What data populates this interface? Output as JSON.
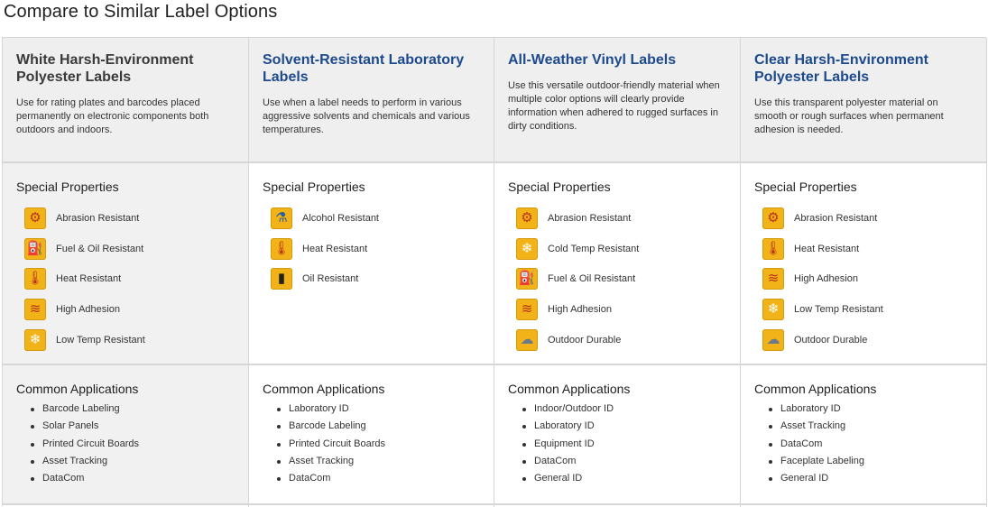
{
  "page": {
    "title": "Compare to Similar Label Options"
  },
  "sections": {
    "special_properties": "Special Properties",
    "common_applications": "Common Applications"
  },
  "products": [
    {
      "name": "White Harsh-Environment Polyester Labels",
      "description": "Use for rating plates and barcodes placed permanently on electronic components both outdoors and indoors.",
      "is_link": false,
      "properties": [
        {
          "label": "Abrasion Resistant",
          "icon": "abrasion-icon"
        },
        {
          "label": "Fuel & Oil Resistant",
          "icon": "fuel-oil-icon"
        },
        {
          "label": "Heat Resistant",
          "icon": "thermometer-flame-icon"
        },
        {
          "label": "High Adhesion",
          "icon": "adhesion-icon"
        },
        {
          "label": "Low Temp Resistant",
          "icon": "snowflake-thermometer-icon"
        }
      ],
      "applications": [
        "Barcode Labeling",
        "Solar Panels",
        "Printed Circuit Boards",
        "Asset Tracking",
        "DataCom"
      ]
    },
    {
      "name": "Solvent-Resistant Laboratory Labels",
      "description": "Use when a label needs to perform in various aggressive solvents and chemicals and various temperatures.",
      "is_link": true,
      "properties": [
        {
          "label": "Alcohol Resistant",
          "icon": "alcohol-icon"
        },
        {
          "label": "Heat Resistant",
          "icon": "thermometer-flame-icon"
        },
        {
          "label": "Oil Resistant",
          "icon": "oil-icon"
        }
      ],
      "applications": [
        "Laboratory ID",
        "Barcode Labeling",
        "Printed Circuit Boards",
        "Asset Tracking",
        "DataCom"
      ]
    },
    {
      "name": "All-Weather Vinyl Labels",
      "description": "Use this versatile outdoor-friendly material when multiple color options will clearly provide information when adhered to rugged surfaces in dirty conditions.",
      "is_link": true,
      "properties": [
        {
          "label": "Abrasion Resistant",
          "icon": "abrasion-icon"
        },
        {
          "label": "Cold Temp Resistant",
          "icon": "snowflake-icon"
        },
        {
          "label": "Fuel & Oil Resistant",
          "icon": "fuel-oil-icon"
        },
        {
          "label": "High Adhesion",
          "icon": "adhesion-icon"
        },
        {
          "label": "Outdoor Durable",
          "icon": "weather-cloud-icon"
        }
      ],
      "applications": [
        "Indoor/Outdoor ID",
        "Laboratory ID",
        "Equipment ID",
        "DataCom",
        "General ID"
      ]
    },
    {
      "name": "Clear Harsh-Environment Polyester Labels",
      "description": "Use this transparent polyester material on smooth or rough surfaces when permanent adhesion is needed.",
      "is_link": true,
      "properties": [
        {
          "label": "Abrasion Resistant",
          "icon": "abrasion-icon"
        },
        {
          "label": "Heat Resistant",
          "icon": "thermometer-flame-icon"
        },
        {
          "label": "High Adhesion",
          "icon": "adhesion-icon"
        },
        {
          "label": "Low Temp Resistant",
          "icon": "snowflake-thermometer-icon"
        },
        {
          "label": "Outdoor Durable",
          "icon": "weather-cloud-icon"
        }
      ],
      "applications": [
        "Laboratory ID",
        "Asset Tracking",
        "DataCom",
        "Faceplate Labeling",
        "General ID"
      ]
    }
  ],
  "colors": {
    "link_title": "#1d4a8c",
    "icon_background": "#f2b318",
    "header_background": "#efefef",
    "border": "#d6d6d6"
  }
}
